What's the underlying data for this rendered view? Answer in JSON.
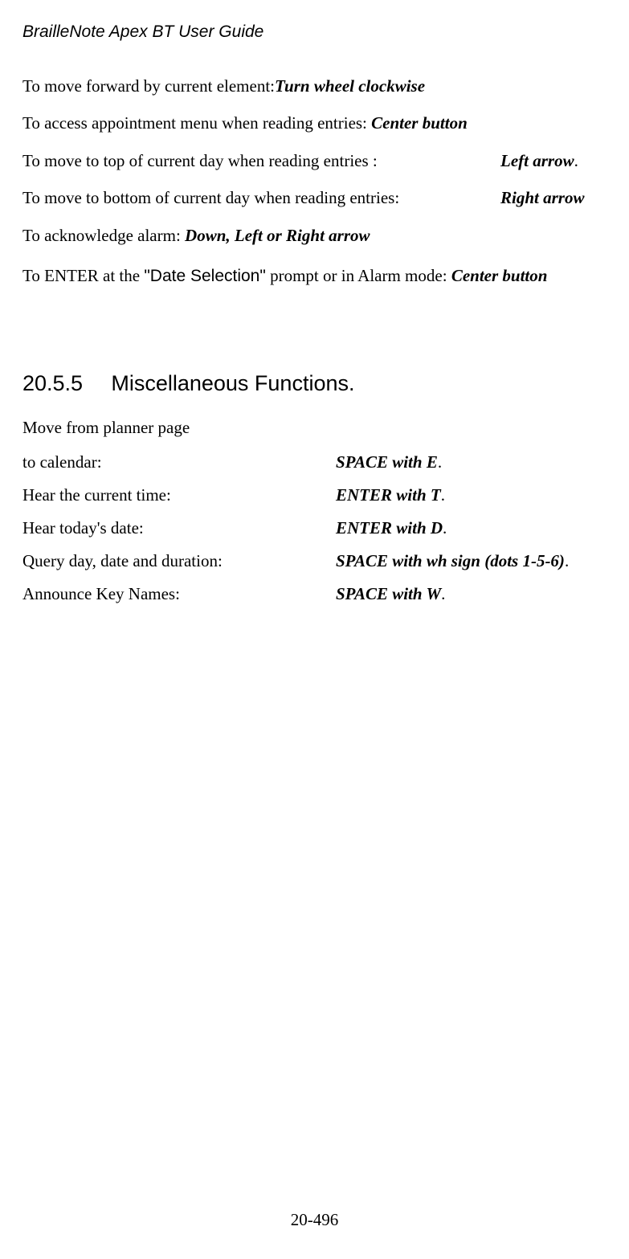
{
  "header": {
    "title": "BrailleNote Apex BT User Guide"
  },
  "paras": {
    "p1_a": "To move forward by current element:",
    "p1_b": "Turn wheel clockwise",
    "p2_a": "To access appointment menu when reading entries: ",
    "p2_b": "Center button",
    "p3_a": "To move to top of current day when reading entries :",
    "p3_b": "Left arrow",
    "p3_c": ".",
    "p4_a": "To move to bottom of current day when reading entries:",
    "p4_b": "Right arrow",
    "p5_a": "To acknowledge alarm: ",
    "p5_b": "Down, Left or Right arrow",
    "p6_a": "To ENTER at the ",
    "p6_b": "\"Date Selection\"",
    "p6_c": " prompt or in Alarm mode: ",
    "p6_d": "Center button"
  },
  "section": {
    "number": "20.5.5",
    "title": "Miscellaneous Functions."
  },
  "misc": {
    "intro": "Move from planner page",
    "r1_a": "to calendar:",
    "r1_b": "SPACE with E",
    "r1_c": ".",
    "r2_a": "Hear the current time:",
    "r2_b": "ENTER with T",
    "r2_c": ".",
    "r3_a": "Hear today's date:",
    "r3_b": "ENTER with D",
    "r3_c": ".",
    "r4_a": "Query day, date and duration:",
    "r4_b": "SPACE with wh sign (dots 1-5-6)",
    "r4_c": ".",
    "r5_a": "Announce Key Names:",
    "r5_b": "SPACE with W",
    "r5_c": "."
  },
  "footer": {
    "page": "20-496"
  }
}
